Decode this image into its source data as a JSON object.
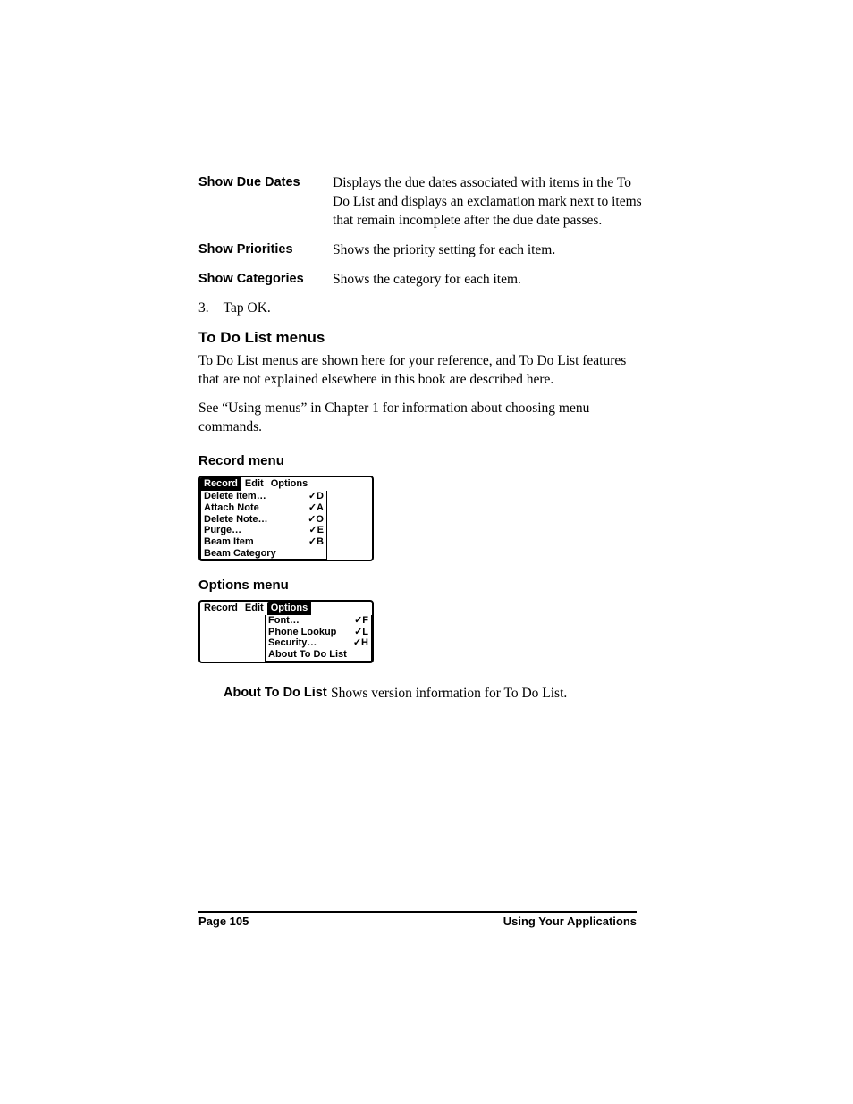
{
  "defs": [
    {
      "term": "Show Due Dates",
      "desc": "Displays the due dates associated with items in the To Do List and displays an exclamation mark next to items that remain incomplete after the due date passes."
    },
    {
      "term": "Show Priorities",
      "desc": "Shows the priority setting for each item."
    },
    {
      "term": "Show Categories",
      "desc": "Shows the category for each item."
    }
  ],
  "step3": {
    "num": "3.",
    "text": "Tap OK."
  },
  "h2": "To Do List menus",
  "para1": "To Do List menus are shown here for your reference, and To Do List features that are not explained elsewhere in this book are described here.",
  "para2": "See “Using menus” in Chapter 1 for information about choosing menu commands.",
  "h3a": "Record menu",
  "recordMenu": {
    "bar": {
      "record": "Record",
      "edit": "Edit",
      "options": "Options"
    },
    "items": [
      {
        "label": "Delete Item…",
        "sc": "✓D"
      },
      {
        "label": "Attach Note",
        "sc": "✓A"
      },
      {
        "label": "Delete Note…",
        "sc": "✓O"
      },
      {
        "label": "Purge…",
        "sc": "✓E"
      },
      {
        "label": "Beam Item",
        "sc": "✓B"
      },
      {
        "label": "Beam Category",
        "sc": ""
      }
    ]
  },
  "h3b": "Options menu",
  "optionsMenu": {
    "bar": {
      "record": "Record",
      "edit": "Edit",
      "options": "Options"
    },
    "items": [
      {
        "label": "Font…",
        "sc": "✓F"
      },
      {
        "label": "Phone Lookup",
        "sc": "✓L"
      },
      {
        "label": "Security…",
        "sc": "✓H"
      },
      {
        "label": "About To Do List",
        "sc": ""
      }
    ]
  },
  "aboutRow": {
    "term": "About To Do List",
    "desc": "Shows version information for To Do List."
  },
  "footer": {
    "left": "Page 105",
    "right": "Using Your Applications"
  }
}
